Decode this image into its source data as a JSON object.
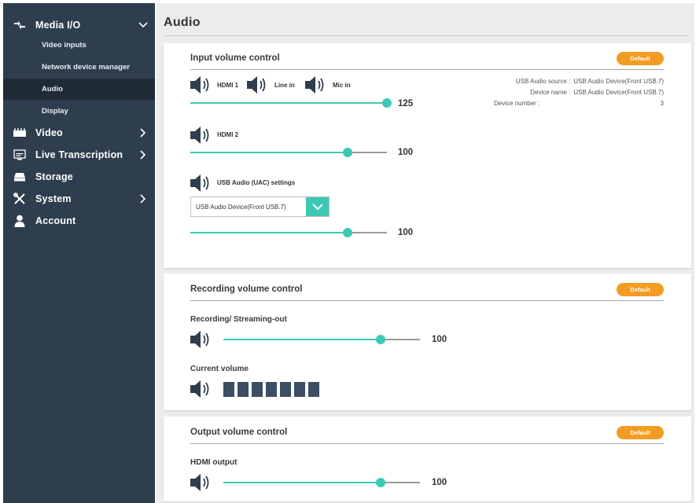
{
  "sidebar": {
    "media_io": "Media I/O",
    "sub_items": [
      "Video inputs",
      "Network device manager",
      "Audio",
      "Display"
    ],
    "video": "Video",
    "live_transcription": "Live Transcription",
    "storage": "Storage",
    "system": "System",
    "account": "Account"
  },
  "page": {
    "title": "Audio"
  },
  "input_card": {
    "title": "Input volume control",
    "default_label": "Default",
    "group1": {
      "hdmi1": "HDMI 1",
      "line_in": "Line in",
      "mic_in": "Mic in",
      "value": 125,
      "value_text": "125",
      "level": 1.0
    },
    "group2": {
      "hdmi2": "HDMI 2",
      "value": 100,
      "value_text": "100",
      "level": 0.8
    },
    "usb": {
      "label": "USB Audio (UAC) settings",
      "selected": "USB Audio Device(Front USB.7)",
      "value": 100,
      "value_text": "100",
      "level": 0.8
    },
    "info": {
      "source_key": "USB Audio source :",
      "source_val": "USB Audio Device(Front USB.7)",
      "name_key": "Device name :",
      "name_val": "USB Audio Device(Front USB.7)",
      "number_key": "Device number :",
      "number_val": "3"
    }
  },
  "recording_card": {
    "title": "Recording volume control",
    "default_label": "Default",
    "rec_label": "Recording/ Streaming-out",
    "value": 100,
    "value_text": "100",
    "level": 0.8,
    "current_label": "Current volume",
    "meter_segments": 7
  },
  "output_card": {
    "title": "Output volume control",
    "default_label": "Default",
    "hdmi_out_label": "HDMI output",
    "value": 100,
    "value_text": "100",
    "level": 0.8
  },
  "colors": {
    "sidebar_bg": "#2f3e4e",
    "accent": "#3cc9b4",
    "default_button": "#f39c24",
    "meter": "#3b4e63"
  }
}
